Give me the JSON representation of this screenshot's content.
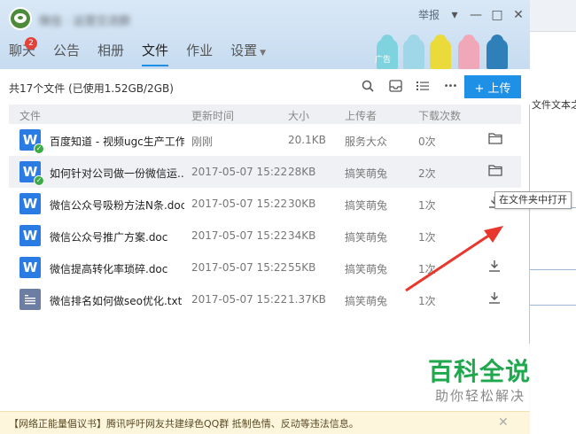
{
  "window": {
    "report": "举报",
    "minimize": "—",
    "maximize": "□",
    "close": "✕",
    "dropdown": "▾"
  },
  "tabs": [
    {
      "label": "聊天",
      "badge": "2"
    },
    {
      "label": "公告"
    },
    {
      "label": "相册"
    },
    {
      "label": "文件",
      "active": true
    },
    {
      "label": "作业"
    },
    {
      "label": "设置"
    }
  ],
  "ad": {
    "label": "广告"
  },
  "toolbar": {
    "file_count": "共17个文件 (已使用1.52GB/2GB)",
    "more": "•••",
    "upload_label": "+ 上传",
    "accent_color": "#1e90e6"
  },
  "table": {
    "headers": {
      "name": "文件",
      "time": "更新时间",
      "size": "大小",
      "uploader": "上传者",
      "downloads": "下载次数"
    },
    "rows": [
      {
        "name": "百度知道 - 视频ugc生产工作...",
        "time": "刚刚",
        "size": "20.1KB",
        "uploader": "服务大众",
        "downloads": "0次",
        "icon": "word",
        "checked": true,
        "action": "folder-icon"
      },
      {
        "name": "如何针对公司做一份微信运...",
        "time": "2017-05-07 15:22",
        "size": "28KB",
        "uploader": "搞笑萌兔",
        "downloads": "2次",
        "icon": "word",
        "checked": true,
        "action": "folder-icon"
      },
      {
        "name": "微信公众号吸粉方法N条.doc",
        "time": "2017-05-07 15:22",
        "size": "30KB",
        "uploader": "搞笑萌兔",
        "downloads": "1次",
        "icon": "word",
        "checked": false,
        "action": "download-icon"
      },
      {
        "name": "微信公众号推广方案.doc",
        "time": "2017-05-07 15:22",
        "size": "34KB",
        "uploader": "搞笑萌兔",
        "downloads": "1次",
        "icon": "word",
        "checked": false,
        "action": "download-icon"
      },
      {
        "name": "微信提高转化率琐碎.doc",
        "time": "2017-05-07 15:22",
        "size": "55KB",
        "uploader": "搞笑萌兔",
        "downloads": "1次",
        "icon": "word",
        "checked": false,
        "action": "download-icon"
      },
      {
        "name": "微信排名如何做seo优化.txt",
        "time": "2017-05-07 15:22",
        "size": "1.37KB",
        "uploader": "搞笑萌兔",
        "downloads": "1次",
        "icon": "txt",
        "checked": false,
        "action": "download-icon"
      }
    ]
  },
  "tooltip": "在文件夹中打开",
  "notice": {
    "text": "【网络正能量倡议书】腾讯呼吁网友共建绿色QQ群 抵制色情、反动等违法信息。",
    "close": "✕"
  },
  "watermark": {
    "main": "百科全说",
    "sub": "助你轻松解决"
  },
  "background_app": {
    "text": "文件文本之"
  }
}
